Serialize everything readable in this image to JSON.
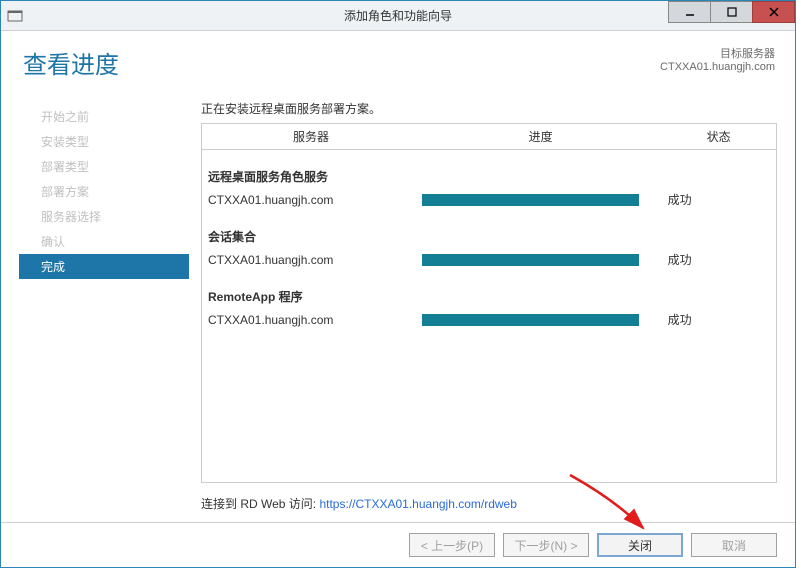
{
  "window": {
    "title": "添加角色和功能向导"
  },
  "header": {
    "page_title": "查看进度",
    "target_label": "目标服务器",
    "target_value": "CTXXA01.huangjh.com"
  },
  "sidebar": {
    "items": [
      {
        "label": "开始之前"
      },
      {
        "label": "安装类型"
      },
      {
        "label": "部署类型"
      },
      {
        "label": "部署方案"
      },
      {
        "label": "服务器选择"
      },
      {
        "label": "确认"
      },
      {
        "label": "完成"
      }
    ],
    "active_index": 6
  },
  "main": {
    "description": "正在安装远程桌面服务部署方案。",
    "headers": {
      "server": "服务器",
      "progress": "进度",
      "status": "状态"
    },
    "groups": [
      {
        "title": "远程桌面服务角色服务",
        "server": "CTXXA01.huangjh.com",
        "status": "成功"
      },
      {
        "title": "会话集合",
        "server": "CTXXA01.huangjh.com",
        "status": "成功"
      },
      {
        "title": "RemoteApp 程序",
        "server": "CTXXA01.huangjh.com",
        "status": "成功"
      }
    ],
    "link_prefix": "连接到 RD Web 访问: ",
    "link_text": "https://CTXXA01.huangjh.com/rdweb"
  },
  "footer": {
    "prev": "< 上一步(P)",
    "next": "下一步(N) >",
    "close": "关闭",
    "cancel": "取消"
  }
}
